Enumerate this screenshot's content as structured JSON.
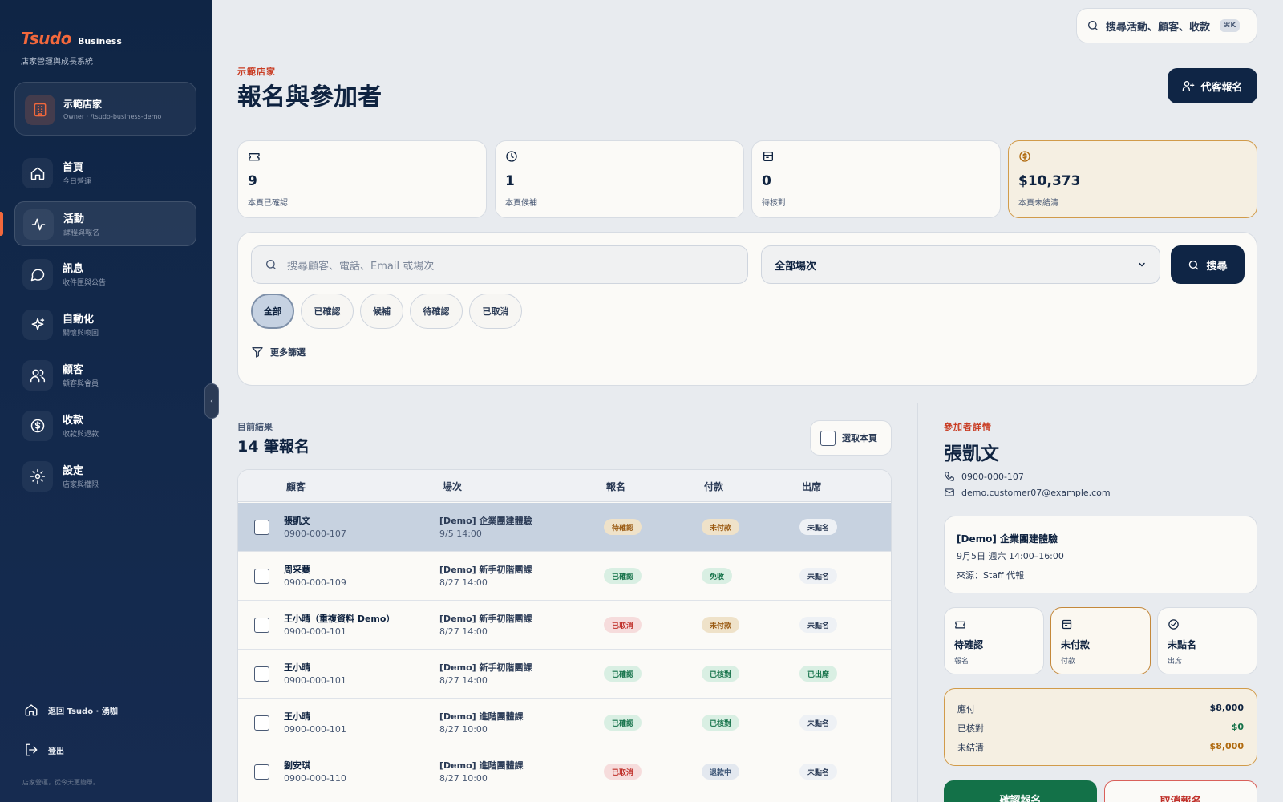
{
  "sidebar": {
    "brand_logo": "Tsudo",
    "brand_sub": "Business",
    "brand_tag": "店家營運與成長系統",
    "store": {
      "name": "示範店家",
      "meta": "Owner · /tsudo-business-demo"
    },
    "items": [
      {
        "label": "首頁",
        "sub": "今日營運",
        "icon": "home-icon"
      },
      {
        "label": "活動",
        "sub": "課程與報名",
        "icon": "activity-icon"
      },
      {
        "label": "訊息",
        "sub": "收件匣與公告",
        "icon": "message-icon"
      },
      {
        "label": "自動化",
        "sub": "關懷與喚回",
        "icon": "sparkle-icon"
      },
      {
        "label": "顧客",
        "sub": "顧客與會員",
        "icon": "users-icon"
      },
      {
        "label": "收款",
        "sub": "收款與退款",
        "icon": "dollar-icon"
      },
      {
        "label": "設定",
        "sub": "店家與權限",
        "icon": "gear-icon"
      }
    ],
    "back_link": "返回 Tsudo · 湧咖",
    "logout": "登出",
    "footer": "店家營運，從今天更簡單。"
  },
  "topbar": {
    "search_placeholder": "搜尋活動、顧客、收款",
    "kbd": "⌘K"
  },
  "header": {
    "eyebrow": "示範店家",
    "title": "報名與參加者",
    "primary_action": "代客報名"
  },
  "stats": [
    {
      "value": "9",
      "label": "本頁已確認",
      "icon": "ticket-icon"
    },
    {
      "value": "1",
      "label": "本頁候補",
      "icon": "clock-icon"
    },
    {
      "value": "0",
      "label": "待核對",
      "icon": "receipt-icon"
    },
    {
      "value": "$10,373",
      "label": "本頁未結清",
      "icon": "coin-icon"
    }
  ],
  "filters": {
    "search_placeholder": "搜尋顧客、電話、Email 或場次",
    "session_select": "全部場次",
    "search_button": "搜尋",
    "chips": [
      "全部",
      "已確認",
      "候補",
      "待確認",
      "已取消"
    ],
    "more": "更多篩選"
  },
  "results": {
    "eyebrow": "目前結果",
    "title": "14 筆報名",
    "select_page": "選取本頁",
    "columns": [
      "顧客",
      "場次",
      "報名",
      "付款",
      "出席"
    ],
    "rows": [
      {
        "name": "張凱文",
        "phone": "0900-000-107",
        "session": "[Demo] 企業團建體驗",
        "time": "9/5 14:00",
        "reg": "待確認",
        "pay": "未付款",
        "att": "未點名"
      },
      {
        "name": "周采蓁",
        "phone": "0900-000-109",
        "session": "[Demo] 新手初階團課",
        "time": "8/27 14:00",
        "reg": "已確認",
        "pay": "免收",
        "att": "未點名"
      },
      {
        "name": "王小晴（重複資料 Demo）",
        "phone": "0900-000-101",
        "session": "[Demo] 新手初階團課",
        "time": "8/27 14:00",
        "reg": "已取消",
        "pay": "未付款",
        "att": "未點名"
      },
      {
        "name": "王小晴",
        "phone": "0900-000-101",
        "session": "[Demo] 新手初階團課",
        "time": "8/27 14:00",
        "reg": "已確認",
        "pay": "已核對",
        "att": "已出席"
      },
      {
        "name": "王小晴",
        "phone": "0900-000-101",
        "session": "[Demo] 進階團體課",
        "time": "8/27 10:00",
        "reg": "已確認",
        "pay": "已核對",
        "att": "未點名"
      },
      {
        "name": "劉安琪",
        "phone": "0900-000-110",
        "session": "[Demo] 進階團體課",
        "time": "8/27 10:00",
        "reg": "已取消",
        "pay": "退款中",
        "att": "未點名"
      }
    ]
  },
  "detail": {
    "eyebrow": "參加者詳情",
    "name": "張凱文",
    "phone": "0900-000-107",
    "email": "demo.customer07@example.com",
    "event_title": "[Demo] 企業團建體驗",
    "event_time": "9月5日 週六 14:00–16:00",
    "event_source": "來源：Staff 代報",
    "statuses": [
      {
        "value": "待確認",
        "label": "報名",
        "icon": "ticket-icon"
      },
      {
        "value": "未付款",
        "label": "付款",
        "icon": "receipt-icon"
      },
      {
        "value": "未點名",
        "label": "出席",
        "icon": "check-circle-icon"
      }
    ],
    "payment": [
      {
        "label": "應付",
        "value": "$8,000",
        "color": "#0f2340"
      },
      {
        "label": "已核對",
        "value": "$0",
        "color": "#137148"
      },
      {
        "label": "未結清",
        "value": "$8,000",
        "color": "#b06a0f"
      }
    ],
    "confirm": "確認報名",
    "cancel": "取消報名"
  },
  "colors": {
    "accent": "#f2683c",
    "navy": "#0f2545",
    "success": "#137148",
    "danger": "#c0312b",
    "warning": "#9a5a12"
  }
}
